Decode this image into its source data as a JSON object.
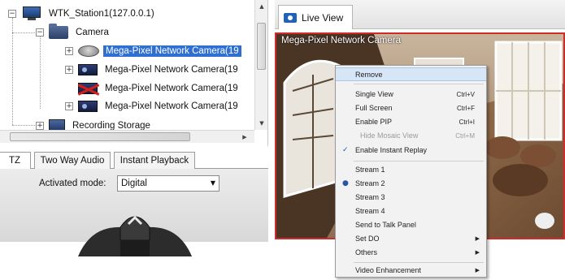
{
  "tree": {
    "station": "WTK_Station1(127.0.0.1)",
    "camera_group": "Camera",
    "cameras": [
      {
        "label": "Mega-Pixel Network Camera(19",
        "state": "selected"
      },
      {
        "label": "Mega-Pixel Network Camera(19",
        "state": "normal"
      },
      {
        "label": "Mega-Pixel Network Camera(19",
        "state": "disconnected"
      },
      {
        "label": "Mega-Pixel Network Camera(19",
        "state": "normal"
      }
    ],
    "recording_storage": "Recording Storage"
  },
  "tabs": {
    "ptz": "TZ",
    "two_way_audio": "Two Way Audio",
    "instant_playback": "Instant Playback"
  },
  "ptz": {
    "activated_mode_label": "Activated mode:",
    "activated_mode_value": "Digital"
  },
  "live_view": {
    "tab_label": "Live View",
    "camera_title": "Mega-Pixel Network Camera"
  },
  "context_menu": {
    "remove": "Remove",
    "single_view": "Single View",
    "single_view_shortcut": "Ctrl+V",
    "full_screen": "Full Screen",
    "full_screen_shortcut": "Ctrl+F",
    "enable_pip": "Enable PIP",
    "enable_pip_shortcut": "Ctrl+I",
    "hide_mosaic_view": "Hide Mosaic View",
    "hide_mosaic_view_shortcut": "Ctrl+M",
    "enable_instant_replay": "Enable Instant Replay",
    "stream1": "Stream 1",
    "stream2": "Stream 2",
    "stream3": "Stream 3",
    "stream4": "Stream 4",
    "send_to_talk_panel": "Send to Talk Panel",
    "set_do": "Set DO",
    "others": "Others",
    "video_enhancement": "Video Enhancement"
  },
  "colors": {
    "selection": "#2f6fd1",
    "video_border": "#cf2b2b",
    "menu_bg": "#f2f2f2"
  },
  "icons": {
    "station": "monitor-icon",
    "group": "folder-icon",
    "camera": "camera-icon",
    "camera_disconnected": "camera-disconnected-icon",
    "storage": "storage-icon",
    "live_view": "camera-icon"
  }
}
